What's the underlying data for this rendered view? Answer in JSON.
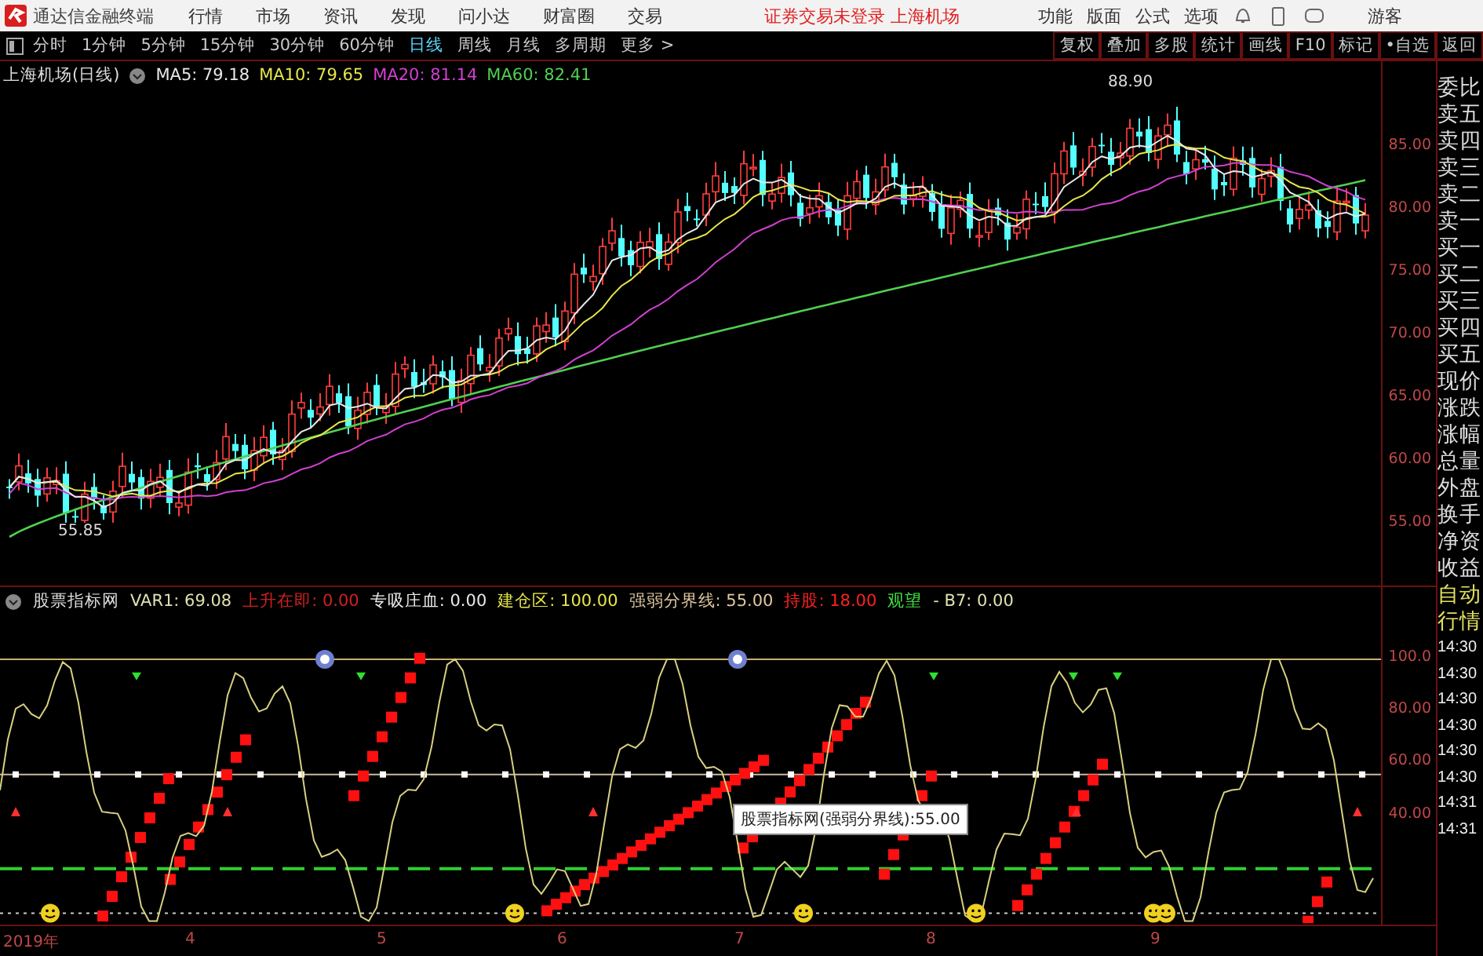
{
  "menu_bar": {
    "app_title": "通达信金融终端",
    "menus": [
      "行情",
      "市场",
      "资讯",
      "发现",
      "问小达",
      "财富圈",
      "交易"
    ],
    "notice": "证券交易未登录 上海机场",
    "tools": [
      "功能",
      "版面",
      "公式",
      "选项"
    ],
    "user": "游客"
  },
  "toolbar": {
    "periods": [
      {
        "label": "分时",
        "selected": false
      },
      {
        "label": "1分钟",
        "selected": false
      },
      {
        "label": "5分钟",
        "selected": false
      },
      {
        "label": "15分钟",
        "selected": false
      },
      {
        "label": "30分钟",
        "selected": false
      },
      {
        "label": "60分钟",
        "selected": false
      },
      {
        "label": "日线",
        "selected": true
      },
      {
        "label": "周线",
        "selected": false
      },
      {
        "label": "月线",
        "selected": false
      },
      {
        "label": "多周期",
        "selected": false
      },
      {
        "label": "更多 >",
        "selected": false
      }
    ],
    "buttons": [
      "复权",
      "叠加",
      "多股",
      "统计",
      "画线",
      "F10",
      "标记",
      "•自选",
      "返回"
    ]
  },
  "price_chart": {
    "title": "上海机场(日线)",
    "ma": [
      {
        "text": "MA5: 79.18",
        "color": "#e8e8e8"
      },
      {
        "text": "MA10: 79.65",
        "color": "#e6e64a"
      },
      {
        "text": "MA20: 81.14",
        "color": "#d040d0"
      },
      {
        "text": "MA60: 82.41",
        "color": "#50d050"
      }
    ],
    "high_label": "88.90",
    "low_label": "55.85",
    "yticks": [
      "85.00",
      "80.00",
      "75.00",
      "70.00",
      "65.00",
      "60.00",
      "55.00"
    ]
  },
  "indicator": {
    "name": "股票指标网",
    "values": [
      {
        "text": "VAR1: 69.08",
        "color": "#e0e0b0"
      },
      {
        "text": "上升在即: 0.00",
        "color": "#d02020"
      },
      {
        "text": "专吸庄血: 0.00",
        "color": "#e8e8e8"
      },
      {
        "text": "建仓区: 100.00",
        "color": "#e6e64a"
      },
      {
        "text": "强弱分界线: 55.00",
        "color": "#e0c8a0"
      },
      {
        "text": "持股: 18.00",
        "color": "#ff2020"
      },
      {
        "text": "观望",
        "color": "#40e040"
      },
      {
        "text": "- B7: 0.00",
        "color": "#e0e0b0"
      }
    ],
    "yticks": [
      "100.0",
      "80.00",
      "60.00",
      "40.00"
    ],
    "tooltip": "股票指标网(强弱分界线):55.00"
  },
  "x_axis": [
    "2019年",
    "4",
    "5",
    "6",
    "7",
    "8",
    "9"
  ],
  "side_panel": {
    "quote_labels": [
      "委比",
      "卖五",
      "卖四",
      "卖三",
      "卖二",
      "卖一",
      "买一",
      "买二",
      "买三",
      "买四",
      "买五",
      "现价",
      "涨跌",
      "涨幅",
      "总量",
      "外盘",
      "换手",
      "净资",
      "收益"
    ],
    "mode_labels": [
      "自动",
      "行情"
    ],
    "times": [
      "14:30",
      "14:30",
      "14:30",
      "14:30",
      "14:30",
      "14:30",
      "14:31",
      "14:31"
    ]
  }
}
